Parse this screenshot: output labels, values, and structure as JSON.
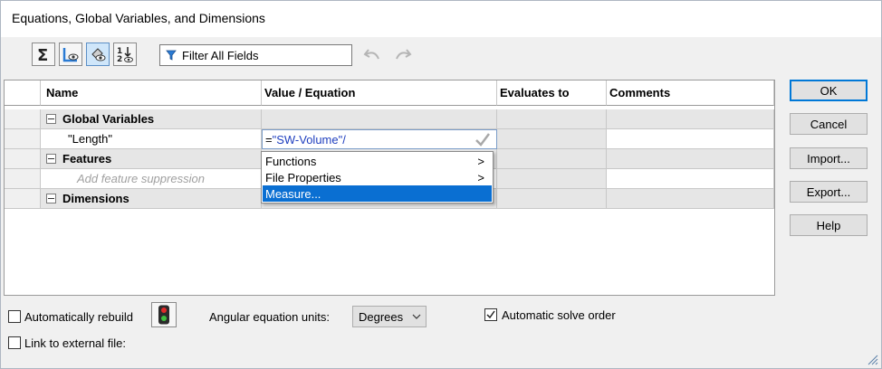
{
  "window": {
    "title": "Equations, Global Variables, and Dimensions"
  },
  "toolbar": {
    "buttons": [
      {
        "icon": "sigma-icon"
      },
      {
        "icon": "dimension-view-icon"
      },
      {
        "icon": "equation-view-icon",
        "active": true
      },
      {
        "icon": "ordered-view-icon"
      }
    ],
    "filter": {
      "value": "Filter All Fields",
      "icon": "filter-icon"
    },
    "undo_icon": "undo-icon",
    "redo_icon": "redo-icon"
  },
  "table": {
    "headers": {
      "name": "Name",
      "value": "Value / Equation",
      "evaluates": "Evaluates to",
      "comments": "Comments"
    },
    "groups": {
      "global_variables": "Global Variables",
      "features": "Features",
      "dimensions": "Dimensions"
    },
    "variable_row": {
      "name": "\"Length\"",
      "value_prefix": "= ",
      "value": "\"SW-Volume\"/"
    },
    "feature_placeholder": "Add feature suppression"
  },
  "dropdown": {
    "items": [
      {
        "label": "Functions",
        "arrow": ">"
      },
      {
        "label": "File Properties",
        "arrow": ">"
      },
      {
        "label": "Measure...",
        "arrow": ""
      }
    ]
  },
  "side_buttons": {
    "ok": "OK",
    "cancel": "Cancel",
    "import": "Import...",
    "export": "Export...",
    "help": "Help"
  },
  "bottom": {
    "auto_rebuild": {
      "label": "Automatically rebuild",
      "checked": false
    },
    "angular_units_label": "Angular equation units:",
    "angular_units_value": "Degrees",
    "auto_solve": {
      "label": "Automatic solve order",
      "checked": true
    },
    "link_external": {
      "label": "Link to external file:",
      "checked": false
    }
  },
  "colors": {
    "accent": "#0a6fd2",
    "equation_text": "#1f3fbf",
    "default_button_border": "#0078d7"
  }
}
